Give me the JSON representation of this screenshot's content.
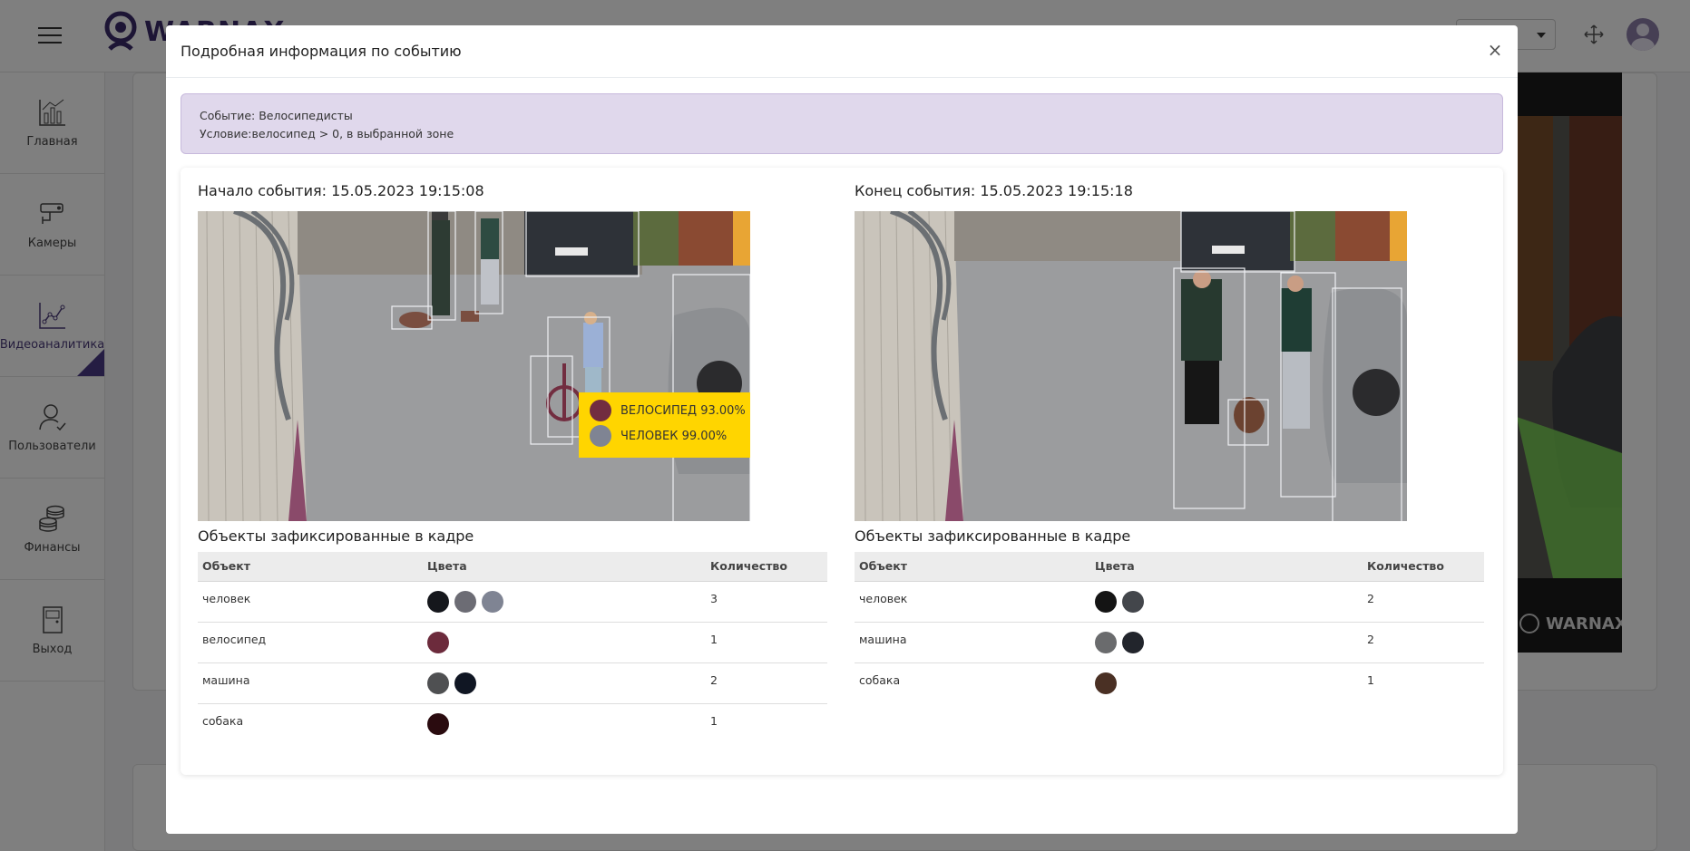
{
  "app": {
    "logo_text": "WARNAX",
    "sidebar": [
      {
        "label": "Главная",
        "icon": "chart-icon"
      },
      {
        "label": "Камеры",
        "icon": "camera-icon"
      },
      {
        "label": "Видеоаналитика",
        "icon": "analytics-icon",
        "active": true
      },
      {
        "label": "Пользователи",
        "icon": "user-icon"
      },
      {
        "label": "Финансы",
        "icon": "coins-icon"
      },
      {
        "label": "Выход",
        "icon": "exit-door-icon"
      }
    ],
    "video_watermark": "WARNAX"
  },
  "modal": {
    "title": "Подробная информация по событию",
    "close_label": "×",
    "event": {
      "type_line": "Событие: Велосипедисты",
      "condition_line": "Условие:велосипед > 0, в выбранной зоне"
    },
    "start": {
      "title": "Начало события: 15.05.2023 19:15:08",
      "objects_title": "Объекты зафиксированные в кадре",
      "headers": {
        "object": "Объект",
        "colors": "Цвета",
        "count": "Количество"
      },
      "rows": [
        {
          "object": "человек",
          "colors": [
            "#15171c",
            "#6c6c74",
            "#7f8493"
          ],
          "count": "3"
        },
        {
          "object": "велосипед",
          "colors": [
            "#6c2b3c"
          ],
          "count": "1"
        },
        {
          "object": "машина",
          "colors": [
            "#4f5052",
            "#101623"
          ],
          "count": "2"
        },
        {
          "object": "собака",
          "colors": [
            "#2a0b0f"
          ],
          "count": "1"
        }
      ],
      "tooltip": [
        {
          "color": "#722d40",
          "text": "ВЕЛОСИПЕД 93.00%"
        },
        {
          "color": "#7f8493",
          "text": "ЧЕЛОВЕК 99.00%"
        }
      ]
    },
    "end": {
      "title": "Конец события: 15.05.2023 19:15:18",
      "objects_title": "Объекты зафиксированные в кадре",
      "headers": {
        "object": "Объект",
        "colors": "Цвета",
        "count": "Количество"
      },
      "rows": [
        {
          "object": "человек",
          "colors": [
            "#141414",
            "#43464b"
          ],
          "count": "2"
        },
        {
          "object": "машина",
          "colors": [
            "#6a6b6d",
            "#22252c"
          ],
          "count": "2"
        },
        {
          "object": "собака",
          "colors": [
            "#4a3024"
          ],
          "count": "1"
        }
      ]
    }
  }
}
